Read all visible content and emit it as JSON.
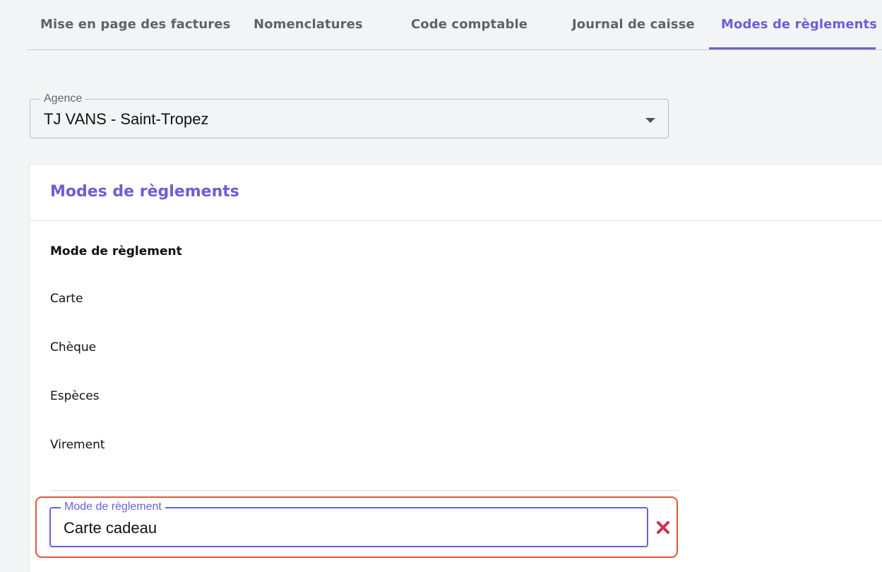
{
  "tabs": [
    {
      "label": "Mise en page des factures",
      "active": false
    },
    {
      "label": "Nomenclatures",
      "active": false
    },
    {
      "label": "Code comptable",
      "active": false
    },
    {
      "label": "Journal de caisse",
      "active": false
    },
    {
      "label": "Modes de règlements",
      "active": true
    }
  ],
  "agency": {
    "label": "Agence",
    "value": "TJ VANS - Saint-Tropez"
  },
  "section": {
    "title": "Modes de règlements",
    "column_header": "Mode de règlement",
    "rows": [
      "Carte",
      "Chèque",
      "Espèces",
      "Virement"
    ]
  },
  "new_entry": {
    "label": "Mode de règlement",
    "value": "Carte cadeau",
    "remove_icon": "close-icon"
  },
  "colors": {
    "accent": "#6b5fd6",
    "highlight": "#e0553f",
    "remove": "#cc2f4f"
  }
}
